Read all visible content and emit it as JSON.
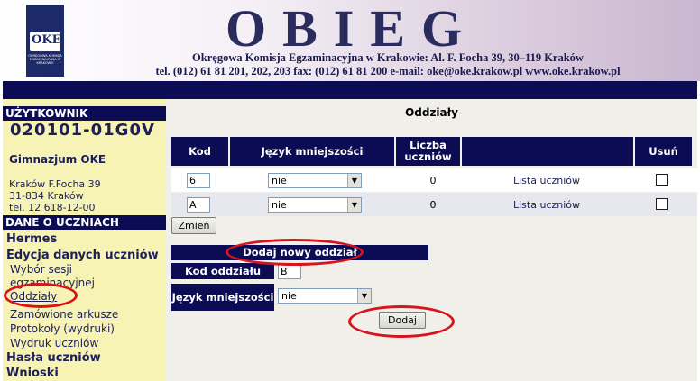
{
  "header": {
    "title": "OBIEG",
    "address_line": "Okręgowa Komisja Egzaminacyjna w Krakowie:  Al. F. Focha 39, 30–119 Kraków",
    "contact_line": "tel. (012) 61 81 201, 202, 203  fax: (012) 61 81 200  e-mail: oke@oke.krakow.pl   www.oke.krakow.pl",
    "logo_mark": "OKE",
    "logo_text": "OKRĘGOWA KOMISJA EGZAMINACYJNA W KRAKOWIE"
  },
  "sidebar": {
    "user_header": "UŻYTKOWNIK",
    "school_code": "020101-01G0V",
    "school_name": "Gimnazjum OKE",
    "address_lines": [
      "Kraków F.Focha 39",
      "31-834 Kraków",
      "tel. 12 618-12-00"
    ],
    "students_header": "DANE O UCZNIACH",
    "items": [
      {
        "label": "Hermes",
        "bold": true
      },
      {
        "label": "Edycja danych uczniów",
        "bold": true
      },
      {
        "label": "Wybór sesji egzaminacyjnej",
        "bold": false
      },
      {
        "label": "Oddziały",
        "bold": false,
        "current": true
      },
      {
        "label": "Zamówione arkusze",
        "bold": false
      },
      {
        "label": "Protokoły (wydruki)",
        "bold": false
      },
      {
        "label": "Wydruk uczniów",
        "bold": false
      },
      {
        "label": "Hasła uczniów",
        "bold": true
      },
      {
        "label": "Wnioski",
        "bold": true
      }
    ]
  },
  "main": {
    "title": "Oddziały",
    "columns": [
      "Kod",
      "Język mniejszości",
      "Liczba uczniów",
      "",
      "Usuń"
    ],
    "rows": [
      {
        "kod": "6",
        "jezyk": "nie",
        "liczba": "0",
        "link": "Lista uczniów",
        "usun": false
      },
      {
        "kod": "A",
        "jezyk": "nie",
        "liczba": "0",
        "link": "Lista uczniów",
        "usun": false
      }
    ],
    "change_button": "Zmień",
    "new_section_header": "Dodaj nowy oddział",
    "new_code_label": "Kod oddziału",
    "new_code_value": "B",
    "new_language_label": "Język mniejszości",
    "new_language_value": "nie",
    "add_button": "Dodaj"
  },
  "colors": {
    "navy": "#0c0c55",
    "sidebar_bg": "#f7f3b5",
    "content_bg": "#f1efe9",
    "annotation_red": "#d6141c"
  }
}
